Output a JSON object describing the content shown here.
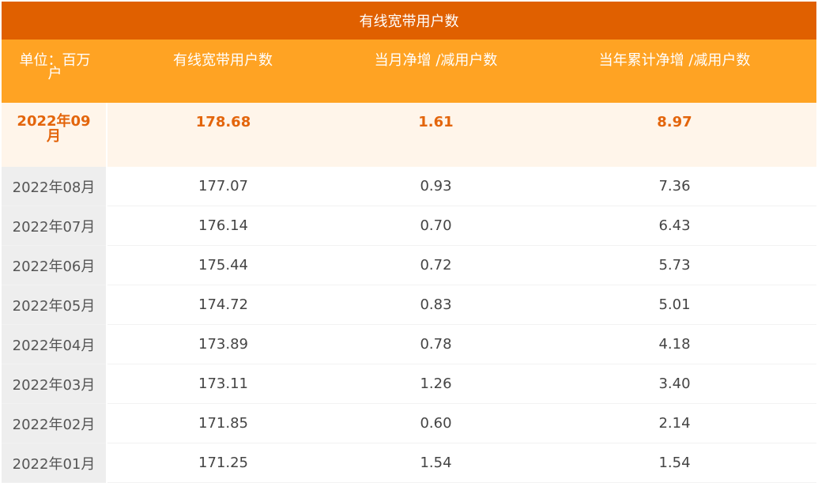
{
  "table": {
    "title": "有线宽带用户数",
    "headers": [
      "单位：百万户",
      "有线宽带用户数",
      "当月净增 /减用户数",
      "当年累计净增 /减用户数"
    ],
    "rows": [
      {
        "month": "2022年09月",
        "users": "178.68",
        "monthly_net": "1.61",
        "ytd_net": "8.97",
        "highlight": true
      },
      {
        "month": "2022年08月",
        "users": "177.07",
        "monthly_net": "0.93",
        "ytd_net": "7.36"
      },
      {
        "month": "2022年07月",
        "users": "176.14",
        "monthly_net": "0.70",
        "ytd_net": "6.43"
      },
      {
        "month": "2022年06月",
        "users": "175.44",
        "monthly_net": "0.72",
        "ytd_net": "5.73"
      },
      {
        "month": "2022年05月",
        "users": "174.72",
        "monthly_net": "0.83",
        "ytd_net": "5.01"
      },
      {
        "month": "2022年04月",
        "users": "173.89",
        "monthly_net": "0.78",
        "ytd_net": "4.18"
      },
      {
        "month": "2022年03月",
        "users": "173.11",
        "monthly_net": "1.26",
        "ytd_net": "3.40"
      },
      {
        "month": "2022年02月",
        "users": "171.85",
        "monthly_net": "0.60",
        "ytd_net": "2.14"
      },
      {
        "month": "2022年01月",
        "users": "171.25",
        "monthly_net": "1.54",
        "ytd_net": "1.54"
      }
    ]
  },
  "colors": {
    "title_bg": "#e06000",
    "header_bg": "#ffa323",
    "highlight_text": "#e3650c",
    "highlight_bg": "#fff5ea",
    "date_col_bg": "#eeeeee"
  }
}
